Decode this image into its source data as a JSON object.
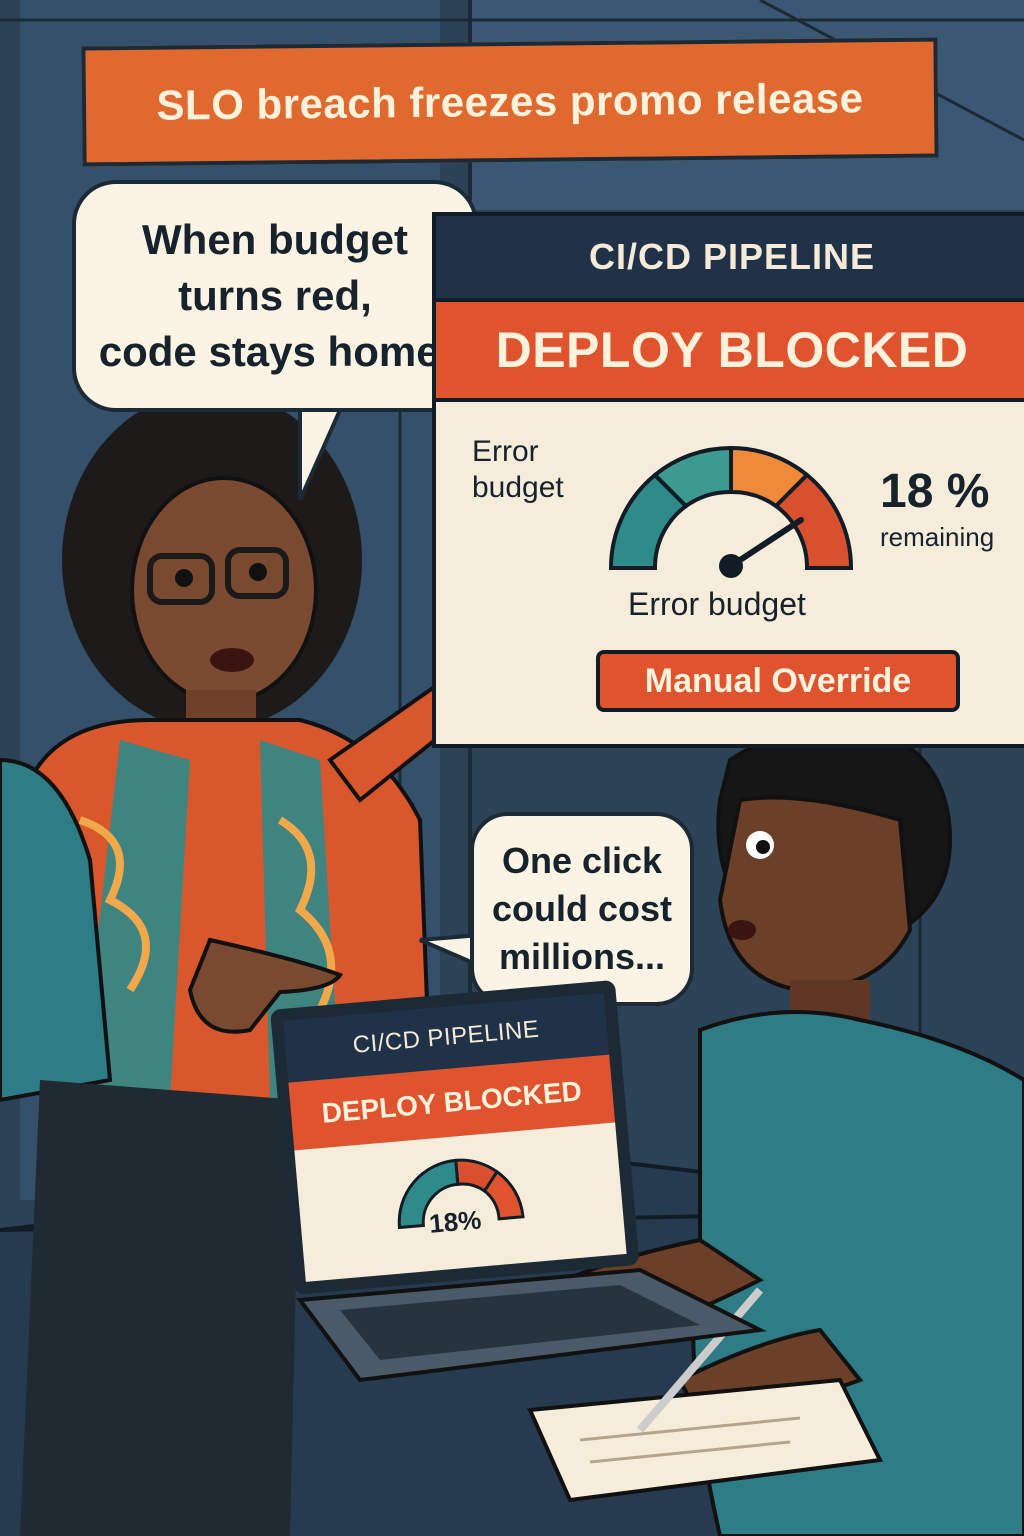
{
  "headline": "SLO breach freezes promo release",
  "bubbles": {
    "lead": "When budget\nturns red,\ncode stays home.",
    "engineer": "One click\ncould cost\nmillions..."
  },
  "monitor": {
    "title": "CI/CD PIPELINE",
    "status": "DEPLOY BLOCKED",
    "gauge_label_left": "Error\nbudget",
    "gauge_caption": "Error budget",
    "percent": "18 %",
    "remaining_label": "remaining",
    "error_budget_remaining_fraction": 0.18,
    "override_button": "Manual Override"
  },
  "laptop": {
    "title": "CI/CD PIPELINE",
    "status": "DEPLOY BLOCKED",
    "percent": "18%"
  },
  "colors": {
    "accent_orange": "#e0692f",
    "alert_red": "#e0532f",
    "navy": "#1f3247",
    "gauge_teal": "#2f8a8a",
    "gauge_orange": "#ef8a3a",
    "gauge_red": "#d9502f"
  }
}
